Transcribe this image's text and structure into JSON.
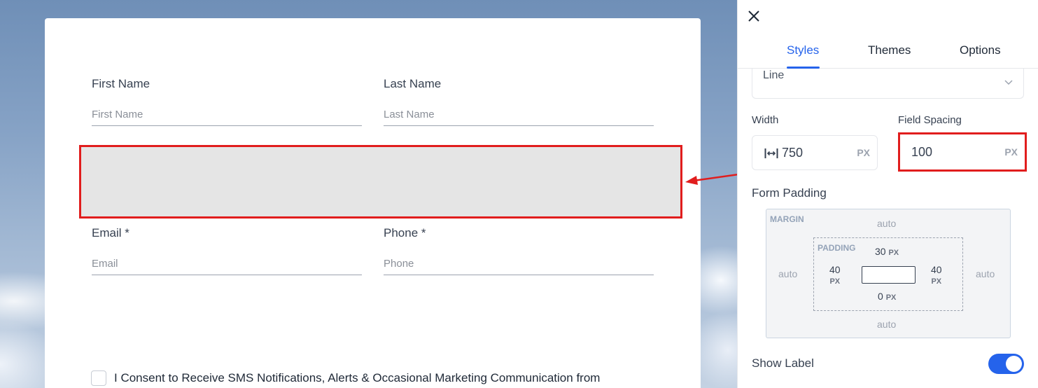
{
  "form": {
    "first_name": {
      "label": "First Name",
      "placeholder": "First Name"
    },
    "last_name": {
      "label": "Last Name",
      "placeholder": "Last Name"
    },
    "email": {
      "label": "Email *",
      "placeholder": "Email"
    },
    "phone": {
      "label": "Phone *",
      "placeholder": "Phone"
    },
    "consent_text": "I Consent to Receive SMS Notifications, Alerts & Occasional Marketing Communication from"
  },
  "panel": {
    "tabs": [
      {
        "label": "Styles",
        "active": true
      },
      {
        "label": "Themes",
        "active": false
      },
      {
        "label": "Options",
        "active": false
      }
    ],
    "style_select": {
      "value": "Line"
    },
    "width": {
      "label": "Width",
      "value": "750",
      "unit": "PX"
    },
    "field_spacing": {
      "label": "Field Spacing",
      "value": "100",
      "unit": "PX"
    },
    "form_padding": {
      "label": "Form Padding",
      "margin_title": "MARGIN",
      "margin_top": "auto",
      "margin_bottom": "auto",
      "margin_left": "auto",
      "margin_right": "auto",
      "padding_title": "PADDING",
      "padding_top": "30",
      "padding_bottom": "0",
      "padding_left": "40",
      "padding_right": "40",
      "unit": "PX"
    },
    "show_label": {
      "label": "Show Label",
      "enabled": true
    }
  },
  "colors": {
    "accent": "#2563eb",
    "highlight": "#e11d1d",
    "spacer_fill": "#e5e5e5"
  },
  "icons": {
    "close": "close-icon",
    "chevron": "chevron-down-icon",
    "width": "width-arrows-icon"
  }
}
